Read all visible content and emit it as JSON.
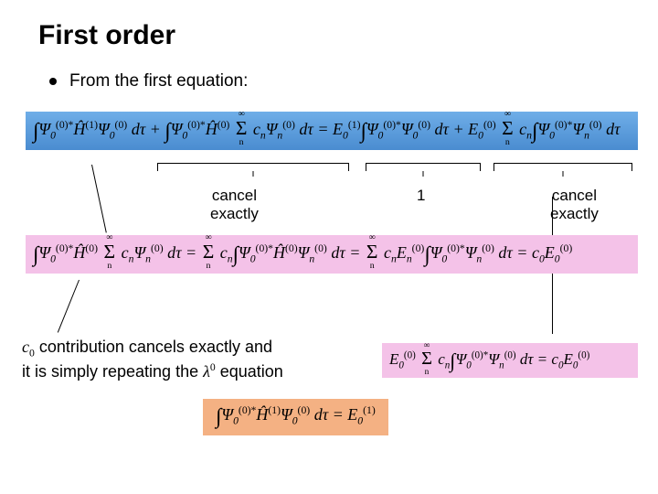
{
  "title": "First order",
  "bullet": "From the first equation:",
  "eq_blue": "∫Ψ₀⁽⁰⁾*Ĥ⁽¹⁾Ψ₀⁽⁰⁾ dτ + ∫Ψ₀⁽⁰⁾*Ĥ⁽⁰⁾ Σₙ cₙΨₙ⁽⁰⁾ dτ = E₀⁽¹⁾ ∫Ψ₀⁽⁰⁾*Ψ₀⁽⁰⁾ dτ + E₀⁽⁰⁾ Σₙ cₙ ∫Ψ₀⁽⁰⁾*Ψₙ⁽⁰⁾ dτ",
  "eq_pink": "∫Ψ₀⁽⁰⁾*Ĥ⁽⁰⁾ Σₙ cₙΨₙ⁽⁰⁾ dτ = Σₙ cₙ ∫Ψ₀⁽⁰⁾*Ĥ⁽⁰⁾Ψₙ⁽⁰⁾ dτ = Σₙ cₙEₙ⁽⁰⁾ ∫Ψ₀⁽⁰⁾*Ψₙ⁽⁰⁾ dτ = c₀E₀⁽⁰⁾",
  "eq_pink2": "E₀⁽⁰⁾ Σₙ cₙ ∫Ψ₀⁽⁰⁾*Ψₙ⁽⁰⁾ dτ = c₀E₀⁽⁰⁾",
  "eq_orange": "∫Ψ₀⁽⁰⁾*Ĥ⁽¹⁾Ψ₀⁽⁰⁾ dτ = E₀⁽¹⁾",
  "annot": {
    "cancel1": "cancel\nexactly",
    "one": "1",
    "cancel2": "cancel\nexactly"
  },
  "body": {
    "line1_pre": "c",
    "line1_sub": "0",
    "line1_post": " contribution cancels exactly and",
    "line2_pre": "it is simply repeating the ",
    "line2_lambda": "λ",
    "line2_sup": "0",
    "line2_post": " equation"
  }
}
